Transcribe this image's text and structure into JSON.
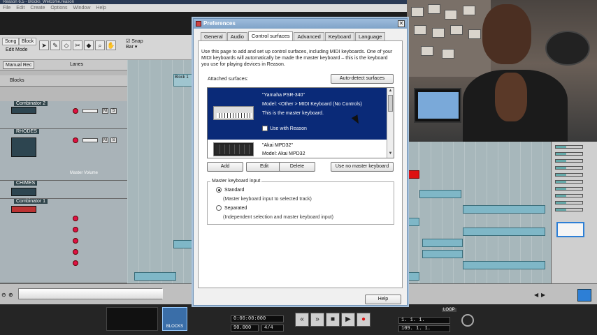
{
  "app": {
    "window_title": "Reason 6.5 - Blocks_Welcome.reason",
    "menu": [
      "File",
      "Edit",
      "Create",
      "Options",
      "Window",
      "Help"
    ]
  },
  "toolbar": {
    "song_tab": "Song",
    "block_tab": "Block",
    "edit_mode": "Edit Mode",
    "snap_label": "Snap",
    "snap_value": "Bar",
    "manual_rec": "Manual Rec",
    "lanes_label": "Lanes"
  },
  "tracks": {
    "blocks": "Blocks",
    "combinator2": "Combinator 2",
    "rhodes": "RHODES",
    "chimes": "CHIMES",
    "combinator1": "Combinator 1",
    "master_volume": "Master Volume",
    "block1_label": "Block 1"
  },
  "transport": {
    "blocks_button": "BLOCKS",
    "time_position": "0:00:00:000",
    "tempo": "90.000",
    "signature": "4/4",
    "loop_label": "LOOP",
    "left_locator": "1. 1. 1.",
    "right_locator": "109. 1. 1."
  },
  "dialog": {
    "title": "Preferences",
    "tabs": [
      "General",
      "Audio",
      "Control surfaces",
      "Advanced",
      "Keyboard",
      "Language"
    ],
    "active_tab": 2,
    "description": "Use this page to add and set up control surfaces, including MIDI keyboards. One of your MIDI keyboards will automatically be made the master keyboard – this is the keyboard you use for playing devices in Reason.",
    "attached_label": "Attached surfaces:",
    "auto_detect": "Auto-detect surfaces",
    "surfaces": [
      {
        "name": "\"Yamaha PSR-340\"",
        "model": "Model: <Other > MIDI Keyboard (No Controls)",
        "status": "This is the master keyboard.",
        "use_with_reason": "Use with Reason"
      },
      {
        "name": "\"Akai MPD32\"",
        "model": "Model: Akai MPD32"
      }
    ],
    "buttons": {
      "add": "Add",
      "edit": "Edit",
      "delete": "Delete",
      "use_no_master": "Use no master keyboard",
      "help": "Help"
    },
    "master_input": {
      "legend": "Master keyboard input",
      "standard": "Standard",
      "standard_desc": "(Master keyboard input to selected track)",
      "separated": "Separated",
      "separated_desc": "(Independent selection and master keyboard input)"
    }
  },
  "colors": {
    "selection": "#0a2a78",
    "clip": "#7fb7c7",
    "record": "#dd1111"
  }
}
